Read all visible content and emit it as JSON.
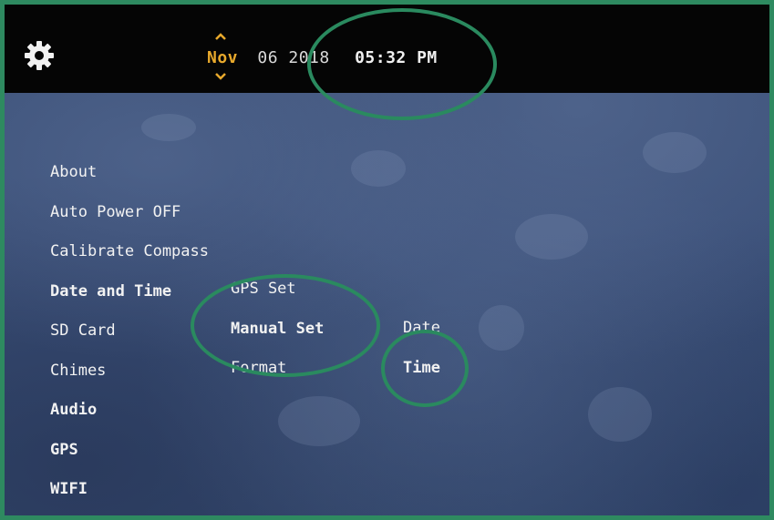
{
  "header": {
    "month": "Nov",
    "day_year": "06 2018",
    "time": "05:32 PM"
  },
  "menu": {
    "items": [
      {
        "label": "About"
      },
      {
        "label": "Auto Power OFF"
      },
      {
        "label": "Calibrate Compass"
      },
      {
        "label": "Date and Time"
      },
      {
        "label": "SD Card"
      },
      {
        "label": "Chimes"
      },
      {
        "label": "Audio"
      },
      {
        "label": "GPS"
      },
      {
        "label": "WIFI"
      }
    ]
  },
  "submenu": {
    "items": [
      {
        "label": "GPS Set"
      },
      {
        "label": "Manual Set"
      },
      {
        "label": "Format"
      }
    ]
  },
  "submenu2": {
    "items": [
      {
        "label": "Date"
      },
      {
        "label": "Time"
      }
    ]
  },
  "colors": {
    "frame": "#2e8a60",
    "month_accent": "#e8a92c",
    "annotation": "#2a8a5f"
  },
  "icons": {
    "settings": "gear-icon",
    "up": "chevron-up-icon",
    "down": "chevron-down-icon"
  }
}
